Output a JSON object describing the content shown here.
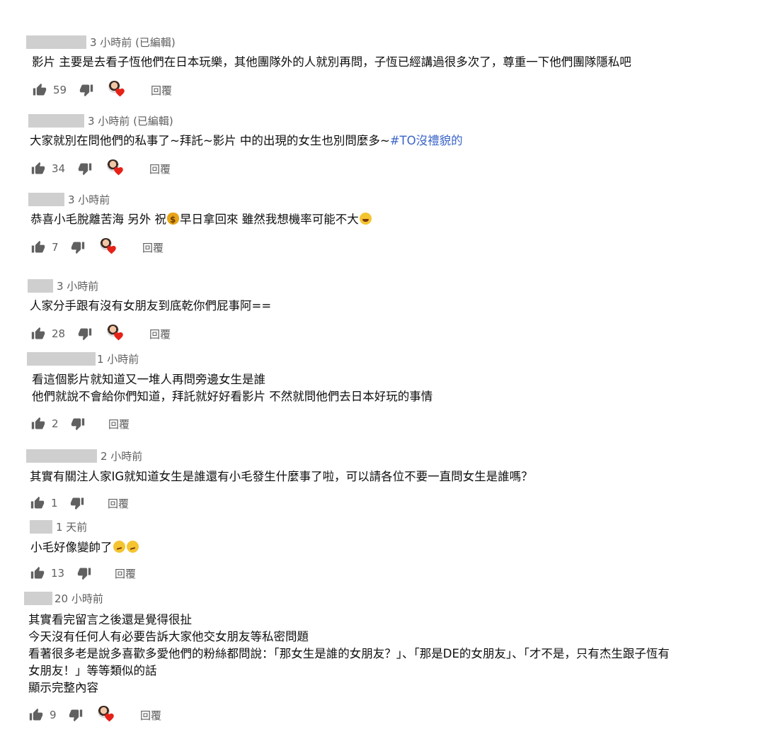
{
  "comments": [
    {
      "time": "3 小時前 (已編輯)",
      "lines": [
        "影片 主要是去看子恆他們在日本玩樂，其他團隊外的人就別再問，子恆已經講過很多次了，尊重一下他們團隊隱私吧"
      ],
      "likes": "59",
      "heart": true,
      "reply": "回覆"
    },
    {
      "time": "3 小時前 (已編輯)",
      "text_main": "大家就別在問他們的私事了~拜託~影片 中的出現的女生也別問麼多~",
      "hashtag": "#TO沒禮貌的",
      "likes": "34",
      "heart": true,
      "reply": "回覆"
    },
    {
      "time": "3 小時前",
      "text_a": "恭喜小毛脫離苦海 另外 祝",
      "text_b": "早日拿回來 雖然我想機率可能不大",
      "emoji_a": "money-bag-emoji",
      "emoji_b": "laughing-emoji",
      "likes": "7",
      "heart": true,
      "reply": "回覆"
    },
    {
      "time": "3 小時前",
      "lines": [
        "人家分手跟有沒有女朋友到底乾你們屁事阿=="
      ],
      "likes": "28",
      "heart": true,
      "reply": "回覆"
    },
    {
      "time": "1 小時前",
      "lines": [
        "看這個影片就知道又一堆人再問旁邊女生是誰",
        "他們就說不會給你們知道，拜託就好好看影片 不然就問他們去日本好玩的事情"
      ],
      "likes": "2",
      "heart": false,
      "reply": "回覆"
    },
    {
      "time": "2 小時前",
      "lines": [
        "其實有關注人家IG就知道女生是誰還有小毛發生什麼事了啦，可以請各位不要一直問女生是誰嗎？"
      ],
      "likes": "1",
      "heart": false,
      "reply": "回覆"
    },
    {
      "time": "1 天前",
      "text_a": "小毛好像變帥了",
      "emoji": "thinking-emoji",
      "likes": "13",
      "heart": false,
      "reply": "回覆"
    },
    {
      "time": "20 小時前",
      "lines": [
        "其實看完留言之後還是覺得很扯",
        "今天沒有任何人有必要告訴大家他交女朋友等私密問題",
        "看著很多老是說多喜歡多愛他們的粉絲都問說：「那女生是誰的女朋友？」、「那是DE的女朋友」、「才不是，只有杰生跟子恆有",
        "女朋友！」等等類似的話",
        "顯示完整內容"
      ],
      "likes": "9",
      "heart": true,
      "reply": "回覆"
    }
  ],
  "colors": {
    "author_placeholder": "#cfcfcf",
    "meta_text": "#606060",
    "hashtag": "#3a64c8",
    "heart": "#e62117"
  }
}
